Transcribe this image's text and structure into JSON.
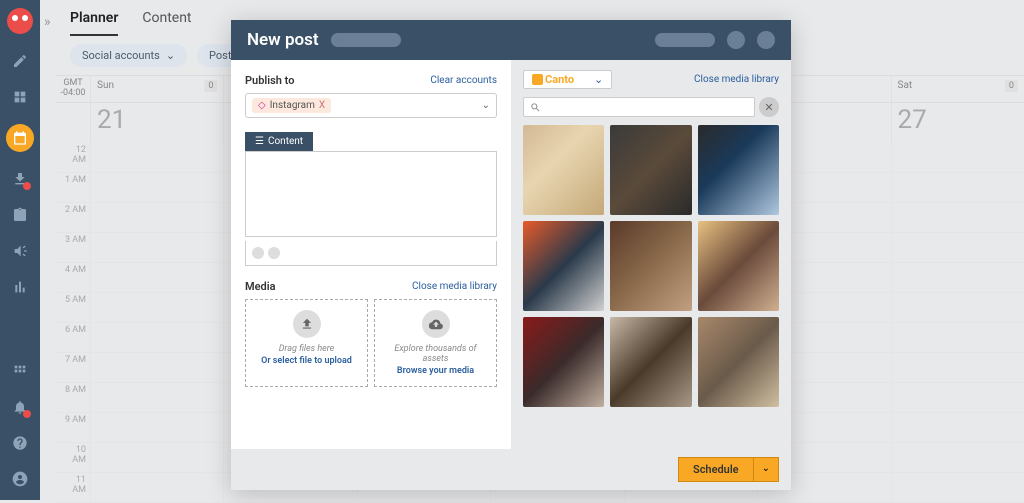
{
  "tabs": {
    "planner": "Planner",
    "content": "Content"
  },
  "filters": {
    "social": "Social accounts",
    "status": "Post status"
  },
  "tz": {
    "l1": "GMT",
    "l2": "-04:00"
  },
  "days": {
    "sun": "Sun",
    "sat": "Sat"
  },
  "dates": {
    "d21": "21",
    "d27": "27"
  },
  "badge0": "0",
  "hours": [
    "12 AM",
    "1 AM",
    "2 AM",
    "3 AM",
    "4 AM",
    "5 AM",
    "6 AM",
    "7 AM",
    "8 AM",
    "9 AM",
    "10 AM",
    "11 AM"
  ],
  "modal": {
    "title": "New post",
    "publish_to": "Publish to",
    "clear_accounts": "Clear accounts",
    "account": "Instagram",
    "chip_x": "X",
    "content_tab": "Content",
    "media": "Media",
    "close_media": "Close media library",
    "drag": "Drag files here",
    "or_select": "Or select file to upload",
    "explore": "Explore thousands of assets",
    "browse": "Browse your media",
    "canto": "Canto",
    "schedule": "Schedule"
  }
}
